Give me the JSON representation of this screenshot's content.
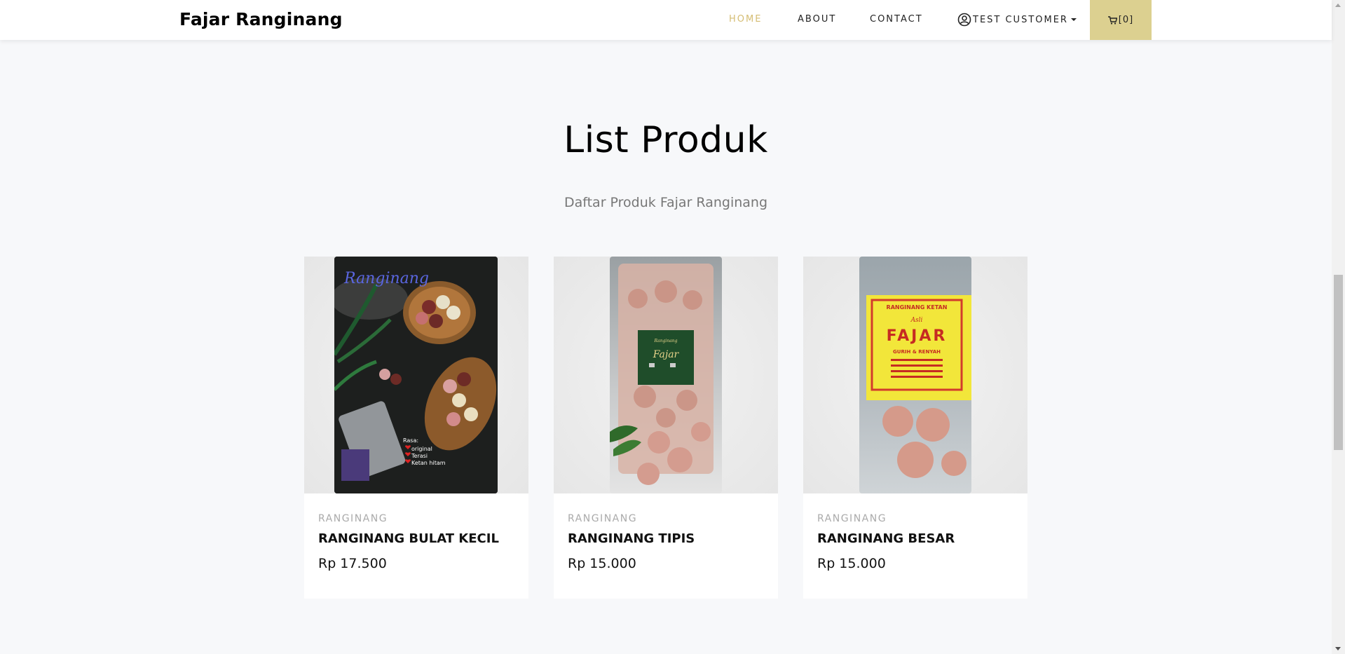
{
  "brand": "Fajar Ranginang",
  "nav": {
    "home": "Home",
    "about": "About",
    "contact": "Contact",
    "user": "Test Customer",
    "cart": "[0]"
  },
  "section": {
    "title": "List Produk",
    "subtitle": "Daftar Produk Fajar Ranginang"
  },
  "products": [
    {
      "category": "RANGINANG",
      "name": "RANGINANG BULAT KECIL",
      "price": "Rp 17.500",
      "image_text": {
        "script": "Ranginang",
        "rasa": "Rasa:",
        "flavors": [
          "original",
          "Terasi",
          "Ketan hitam"
        ]
      }
    },
    {
      "category": "RANGINANG",
      "name": "RANGINANG TIPIS",
      "price": "Rp 15.000",
      "image_text": {
        "label": "Fajar"
      }
    },
    {
      "category": "RANGINANG",
      "name": "RANGINANG BESAR",
      "price": "Rp 15.000",
      "image_text": {
        "top": "RANGINANG KETAN",
        "asli": "Asli",
        "label": "FAJAR",
        "sub": "GURIH & RENYAH"
      }
    }
  ],
  "colors": {
    "accent": "#d5bd73",
    "cart_bg": "#dcd090",
    "bg": "#f7f8fa"
  }
}
